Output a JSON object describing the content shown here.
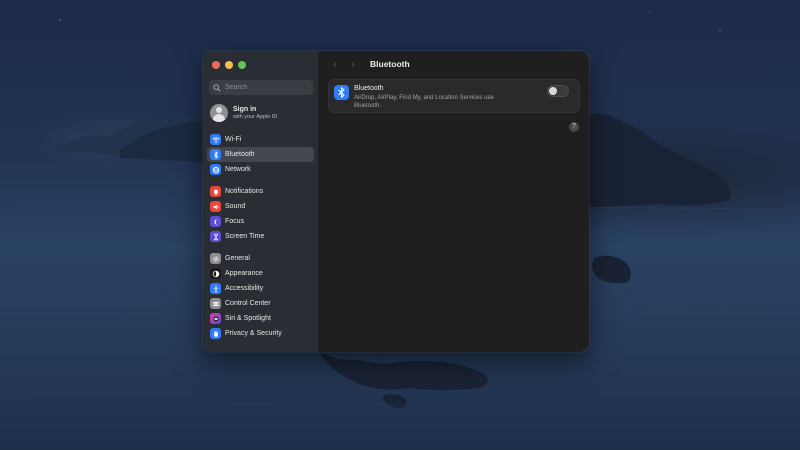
{
  "window": {
    "pane_title": "Bluetooth",
    "back_arrow": "‹",
    "forward_arrow": "›"
  },
  "sidebar": {
    "search_placeholder": "Search",
    "signin": {
      "title": "Sign in",
      "subtitle": "with your Apple ID"
    },
    "items": [
      {
        "label": "Wi-Fi",
        "icon": "wifi-icon",
        "color": "#2f7cf6"
      },
      {
        "label": "Bluetooth",
        "icon": "bluetooth-icon",
        "color": "#2f7cf6",
        "selected": true
      },
      {
        "label": "Network",
        "icon": "globe-icon",
        "color": "#2f7cf6"
      },
      {
        "label": "Notifications",
        "icon": "bell-icon",
        "color": "#e9463c"
      },
      {
        "label": "Sound",
        "icon": "speaker-icon",
        "color": "#e9463c"
      },
      {
        "label": "Focus",
        "icon": "moon-icon",
        "color": "#5a4fd6"
      },
      {
        "label": "Screen Time",
        "icon": "hourglass-icon",
        "color": "#5a4fd6"
      },
      {
        "label": "General",
        "icon": "gear-icon",
        "color": "#8e8e93"
      },
      {
        "label": "Appearance",
        "icon": "appearance-icon",
        "color": "#1c1c1e"
      },
      {
        "label": "Accessibility",
        "icon": "accessibility-icon",
        "color": "#2f7cf6"
      },
      {
        "label": "Control Center",
        "icon": "control-center-icon",
        "color": "#8e8e93"
      },
      {
        "label": "Siri & Spotlight",
        "icon": "siri-icon",
        "color": "#b43bd1"
      },
      {
        "label": "Privacy & Security",
        "icon": "hand-icon",
        "color": "#2f7cf6"
      }
    ]
  },
  "bluetooth": {
    "title": "Bluetooth",
    "description": "AirDrop, AirPlay, Find My, and Location Services use Bluetooth.",
    "enabled": false
  },
  "help_label": "?",
  "colors": {
    "accent": "#2f7cf6",
    "sidebar_bg": "#2a2d33",
    "content_bg": "#1f1f20"
  }
}
